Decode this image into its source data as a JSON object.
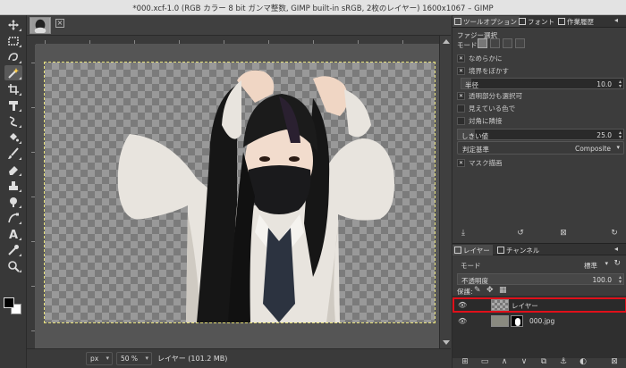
{
  "window": {
    "title": "*000.xcf-1.0 (RGB カラー 8 bit ガンマ整数, GIMP built-in sRGB, 2枚のレイヤー) 1600x1067 – GIMP"
  },
  "toolbox": {
    "tools": [
      "move-icon",
      "rect-select-icon",
      "free-select-icon",
      "fuzzy-select-icon",
      "crop-icon",
      "transform-icon",
      "warp-icon",
      "bucket-fill-icon",
      "paintbrush-icon",
      "eraser-icon",
      "clone-icon",
      "smudge-icon",
      "path-icon",
      "text-icon",
      "color-picker-icon",
      "zoom-icon"
    ],
    "fg_color": "#000000",
    "bg_color": "#ffffff"
  },
  "statusbar": {
    "unit": "px",
    "zoom": "50 %",
    "info": "レイヤー (101.2 MB)"
  },
  "dock": {
    "tabs": [
      "ツールオプション",
      "フォント",
      "作業履歴"
    ],
    "tool_title": "ファジー選択",
    "mode_label": "モード",
    "options": {
      "antialias": "なめらかに",
      "feather": "境界をぼかす",
      "radius_label": "半径",
      "radius_value": "10.0",
      "select_transparent": "透明部分も選択可",
      "sample_merged": "見えている色で",
      "diagonal": "対角に隣接",
      "threshold_label": "しきい値",
      "threshold_value": "25.0",
      "criterion_label": "判定基準",
      "criterion_value": "Composite",
      "draw_mask": "マスク描画"
    }
  },
  "layers": {
    "tabs": [
      "レイヤー",
      "チャンネル"
    ],
    "mode_label": "モード",
    "mode_value": "標準",
    "opacity_label": "不透明度",
    "opacity_value": "100.0",
    "lock_label": "保護:",
    "items": [
      {
        "name": "レイヤー",
        "selected": true
      },
      {
        "name": "000.jpg",
        "selected": false
      }
    ]
  },
  "colors": {
    "selection_highlight": "#e0101a",
    "marching_ants": "#e7e17a"
  }
}
